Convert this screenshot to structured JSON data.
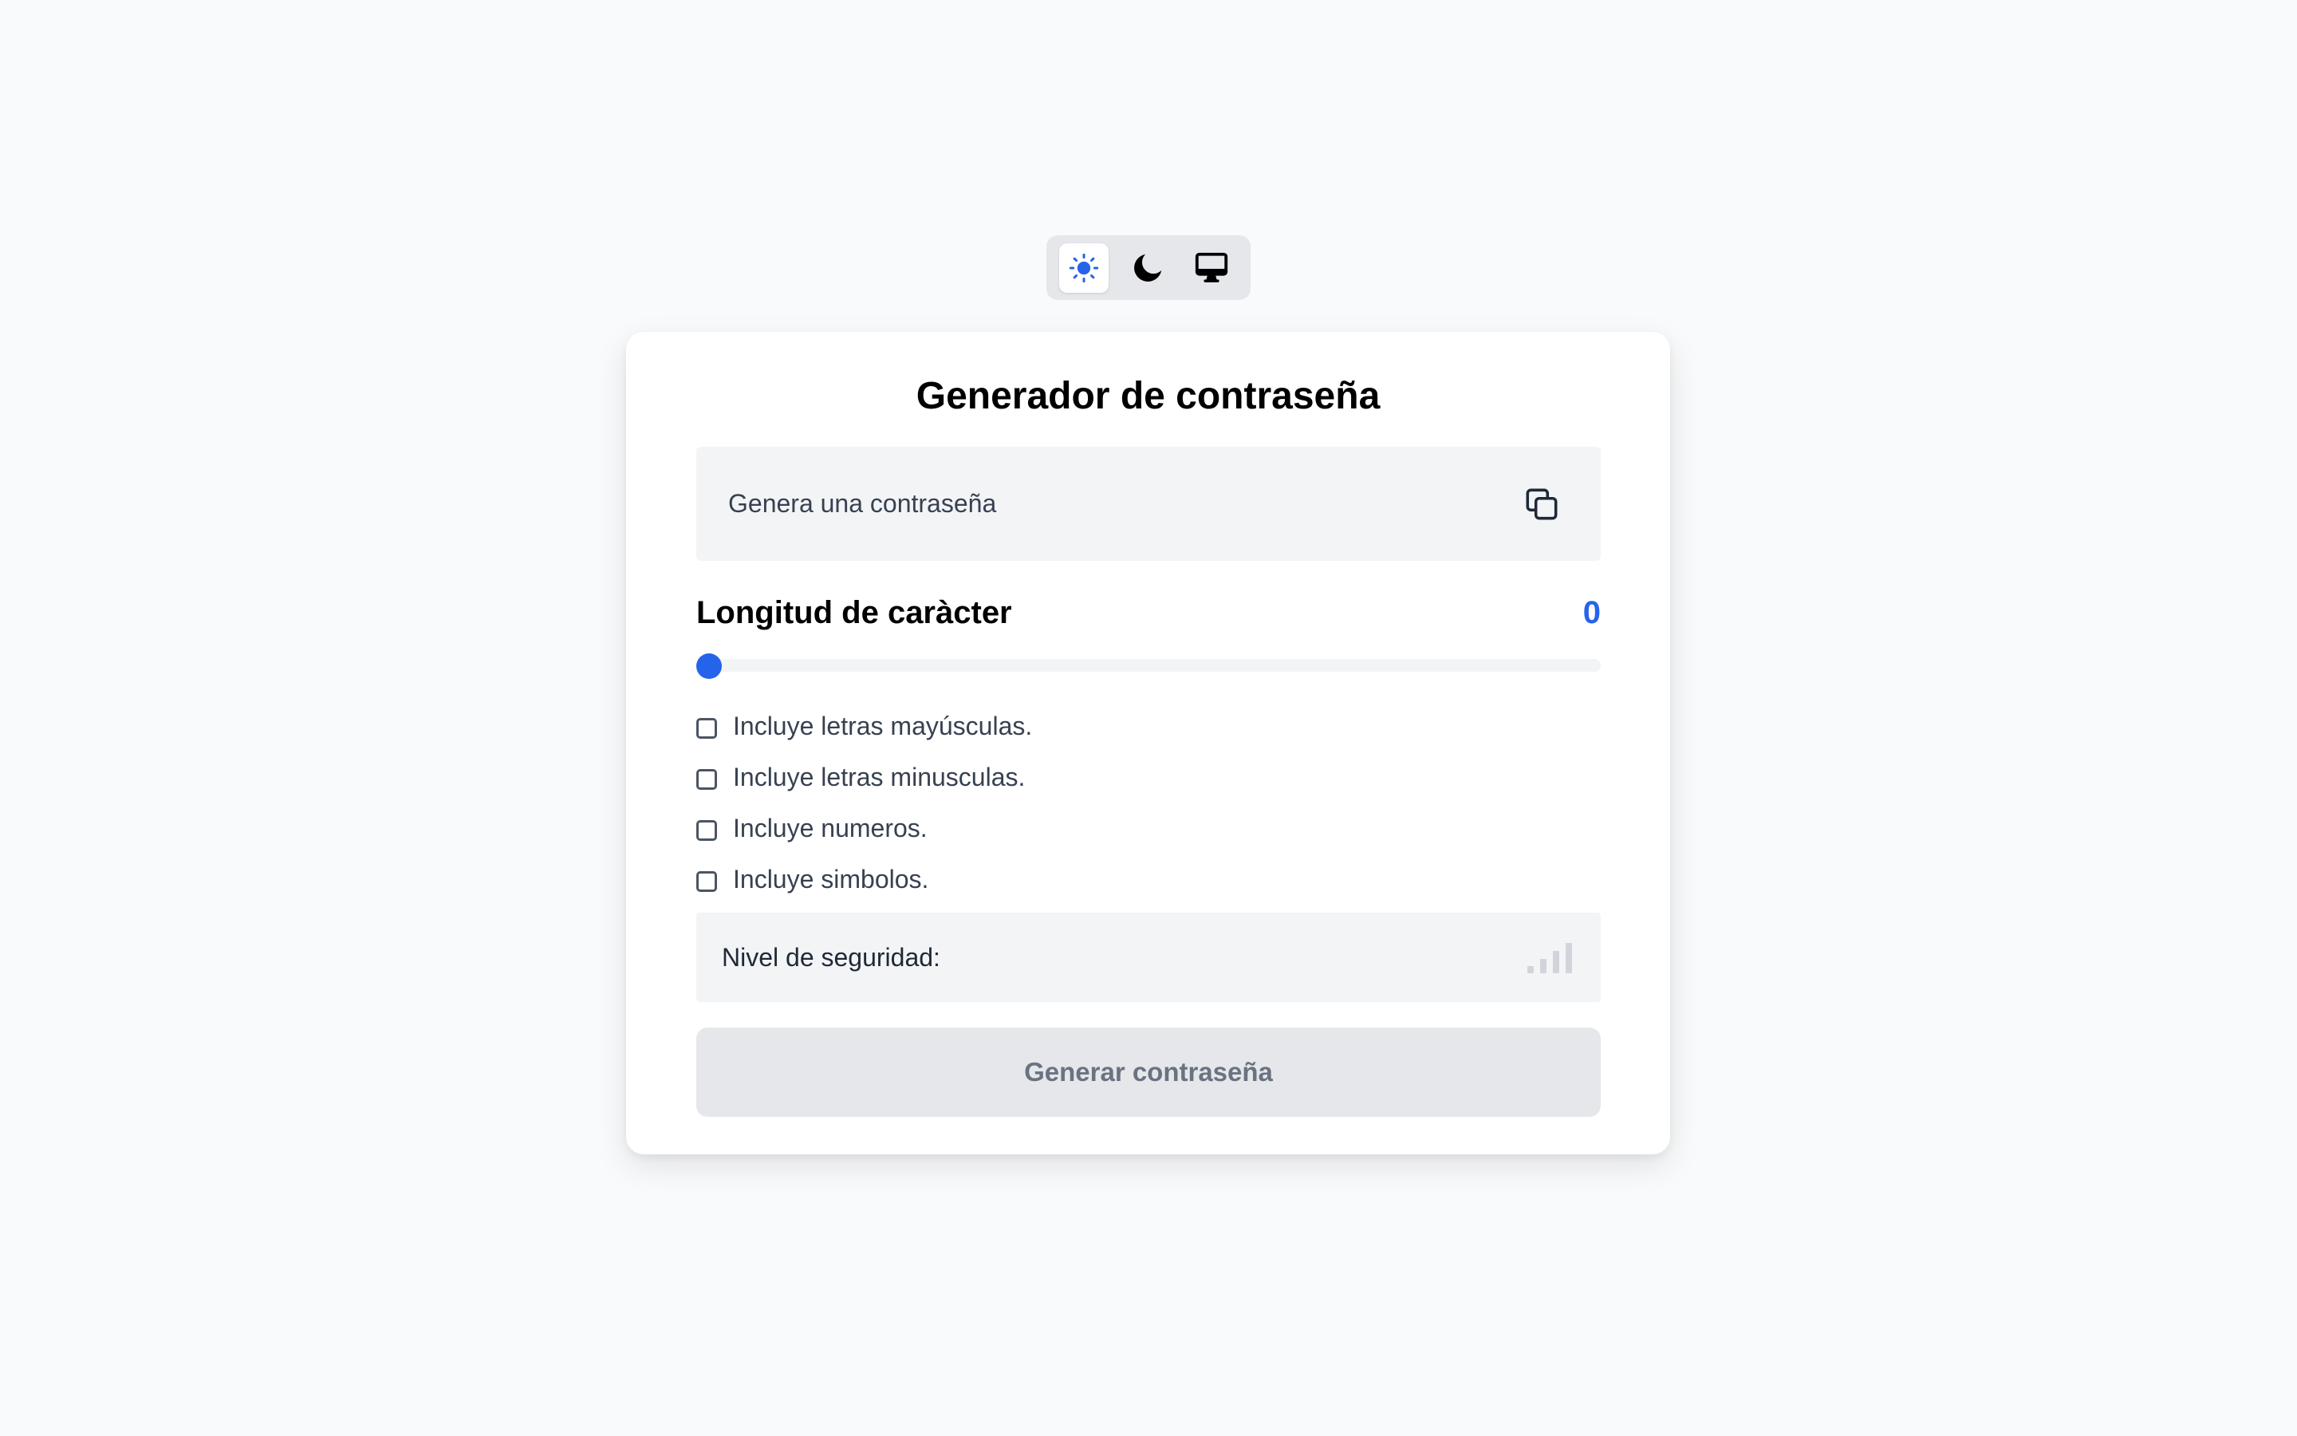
{
  "theme_switcher": {
    "options": [
      {
        "icon": "sun-icon",
        "active": true
      },
      {
        "icon": "moon-icon",
        "active": false
      },
      {
        "icon": "monitor-icon",
        "active": false
      }
    ]
  },
  "card": {
    "title": "Generador de contraseña",
    "password": {
      "placeholder": "Genera una contraseña",
      "copy_icon": "copy-icon"
    },
    "length": {
      "label": "Longitud de caràcter",
      "value": "0"
    },
    "options": [
      {
        "label": "Incluye letras mayúsculas.",
        "checked": false
      },
      {
        "label": "Incluye letras minusculas.",
        "checked": false
      },
      {
        "label": "Incluye numeros.",
        "checked": false
      },
      {
        "label": "Incluye simbolos.",
        "checked": false
      }
    ],
    "strength": {
      "label": "Nivel de seguridad:",
      "icon": "signal-bars-icon"
    },
    "generate_button": "Generar contraseña"
  },
  "colors": {
    "accent": "#2563eb",
    "background": "#f9fafb",
    "panel": "#f3f4f6"
  }
}
